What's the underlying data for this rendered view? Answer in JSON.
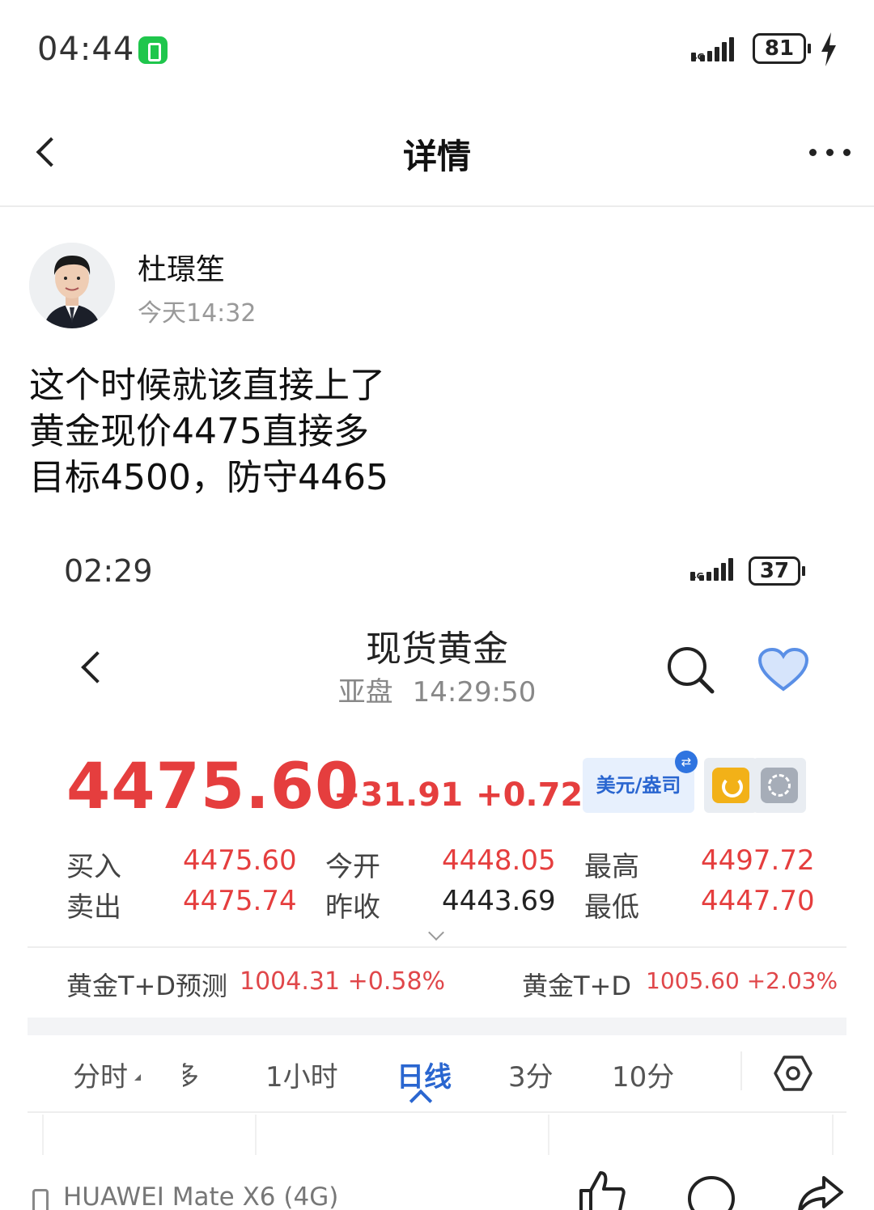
{
  "status_bar": {
    "time": "04:44",
    "battery": "81"
  },
  "header": {
    "title": "详情"
  },
  "author": {
    "name": "杜璟笙",
    "time": "今天14:32"
  },
  "post": {
    "lines": [
      "这个时候就该直接上了",
      "黄金现价4475直接多",
      "目标4500，防守4465"
    ]
  },
  "embedded": {
    "status_time": "02:29",
    "battery": "37",
    "title": "现货黄金",
    "session": "亚盘",
    "clock": "14:29:50",
    "price": "4475.60",
    "change": "+31.91",
    "change_pct": "+0.72%",
    "currency_tag": "美元/盎司",
    "quotes": [
      {
        "label": "买入",
        "value": "4475.60",
        "label2": "今开",
        "value2": "4448.05",
        "label3": "最高",
        "value3": "4497.72"
      },
      {
        "label": "卖出",
        "value": "4475.74",
        "label2": "昨收",
        "value2": "4443.69",
        "label3": "最低",
        "value3": "4447.70"
      }
    ],
    "td_forecast_label": "黄金T+D预测",
    "td_forecast_value": "1004.31 +0.58%",
    "td_label": "黄金T+D",
    "td_value": "1005.60 +2.03%",
    "tabs": [
      "分时",
      "多",
      "1小时",
      "日线",
      "3分",
      "10分"
    ],
    "active_tab": "日线"
  },
  "footer": {
    "device": "HUAWEI Mate X6 (4G)"
  },
  "colors": {
    "price_red": "#e53e3e",
    "accent_blue": "#2a66d0",
    "heart_blue": "#5a8fe6",
    "wechat_green": "#1fc64c"
  }
}
